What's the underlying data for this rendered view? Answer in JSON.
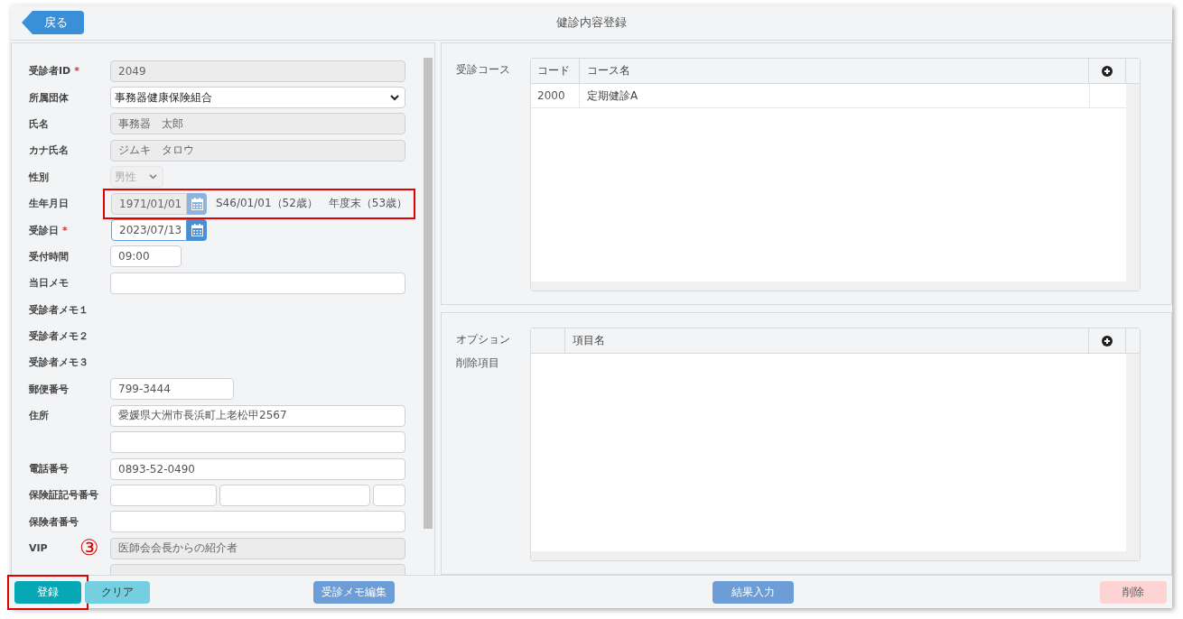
{
  "header": {
    "back_button": "戻る",
    "title": "健診内容登録"
  },
  "form": [
    {
      "label": "受診者ID",
      "mark": "*",
      "kind": "readonly",
      "value": "2049"
    },
    {
      "label": "所属団体",
      "kind": "select",
      "value": "事務器健康保険組合"
    },
    {
      "label": "氏名",
      "kind": "readonly",
      "value": "事務器　太郎"
    },
    {
      "label": "カナ氏名",
      "kind": "readonly",
      "value": "ジムキ　タロウ"
    },
    {
      "label": "性別",
      "kind": "small-select",
      "value": "男性"
    },
    {
      "label": "生年月日",
      "kind": "date",
      "disabled": true,
      "focused": false,
      "highlighted": true,
      "value": "1971/01/01",
      "notes": [
        "S46/01/01（52歳）",
        "年度末（53歳）"
      ]
    },
    {
      "label": "受診日",
      "mark": "*",
      "kind": "date",
      "disabled": false,
      "focused": true,
      "highlighted": false,
      "value": "2023/07/13"
    },
    {
      "label": "受付時間",
      "kind": "time",
      "value": "09:00"
    },
    {
      "label": "当日メモ",
      "kind": "input"
    },
    {
      "label": "受診者メモ１",
      "kind": "none"
    },
    {
      "label": "受診者メモ２",
      "kind": "none"
    },
    {
      "label": "受診者メモ３",
      "kind": "none"
    },
    {
      "label": "郵便番号",
      "kind": "postal",
      "value": "799-3444"
    },
    {
      "label": "住所",
      "kind": "input",
      "value": "愛媛県大洲市長浜町上老松甲2567"
    },
    {
      "kind": "input"
    },
    {
      "label": "電話番号",
      "kind": "input",
      "value": "0893-52-0490"
    },
    {
      "label": "保険証記号番号",
      "kind": "triple"
    },
    {
      "label": "保険者番号",
      "kind": "input"
    },
    {
      "label": "VIP",
      "kind": "readonly",
      "value": "医師会会長からの紹介者",
      "marker": "③"
    },
    {
      "kind": "readonly"
    }
  ],
  "course": {
    "label": "受診コース",
    "columns": [
      "コード",
      "コース名"
    ],
    "rows": [
      [
        "2000",
        "定期健診A"
      ]
    ]
  },
  "options": {
    "labels": [
      "オプション",
      "削除項目"
    ],
    "columns": [
      "",
      "項目名"
    ]
  },
  "footer": [
    {
      "label": "登録",
      "kind": "primary",
      "highlighted": true
    },
    {
      "label": "クリア",
      "kind": "secondary",
      "highlighted": false
    },
    {
      "label": "受診メモ編集",
      "kind": "info",
      "highlighted": false
    },
    {
      "label": "結果入力",
      "kind": "info",
      "highlighted": false
    },
    {
      "label": "削除",
      "kind": "danger",
      "highlighted": false
    }
  ]
}
